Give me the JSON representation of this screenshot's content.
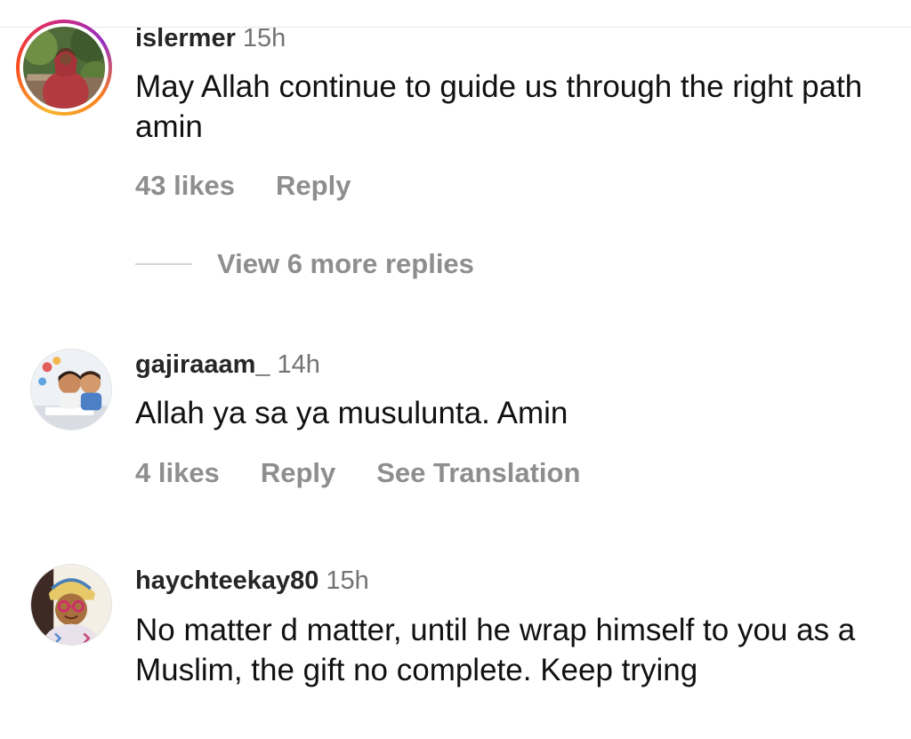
{
  "comments": [
    {
      "username": "islermer",
      "time": "15h",
      "text": "May Allah continue to guide us through the right path amin",
      "likes": "43 likes",
      "reply": "Reply",
      "view_replies": "View 6 more replies",
      "avatar": "woman-outdoors-avatar",
      "has_story_ring": true
    },
    {
      "username": "gajiraaam_",
      "time": "14h",
      "text": "Allah ya sa ya musulunta. Amin",
      "likes": "4 likes",
      "reply": "Reply",
      "translate": "See Translation",
      "avatar": "children-avatar",
      "has_story_ring": false
    },
    {
      "username": "haychteekay80",
      "time": "15h",
      "text": "No matter d matter, until he wrap himself to you as a Muslim, the gift no complete.  Keep trying",
      "avatar": "woman-glasses-avatar",
      "has_story_ring": false
    }
  ],
  "colors": {
    "secondary_text": "#8e8e8e",
    "username": "#262626",
    "body_text": "#111111"
  }
}
